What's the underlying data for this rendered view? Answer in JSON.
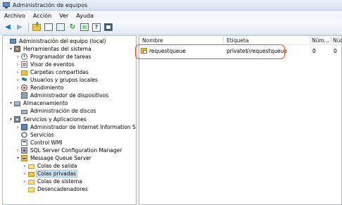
{
  "window": {
    "title": "Administración de equipos"
  },
  "menu": {
    "items": [
      "Archivo",
      "Acción",
      "Ver",
      "Ayuda"
    ]
  },
  "toolbar": {
    "icons": [
      "back-arrow-icon",
      "forward-arrow-icon",
      "up-folder-icon",
      "show-hide-console-tree-icon",
      "properties-icon",
      "refresh-icon",
      "export-list-icon",
      "help-icon",
      "action-pane-icon"
    ]
  },
  "tree": {
    "items": [
      {
        "label": "Administración del equipo (local)",
        "expander": "",
        "icon": "computer-icon"
      },
      {
        "label": "Herramientas del sistema",
        "expander": "▾",
        "icon": "tools-icon"
      },
      {
        "label": "Programador de tareas",
        "expander": "▹",
        "icon": "clock-icon"
      },
      {
        "label": "Visor de eventos",
        "expander": "▹",
        "icon": "event-viewer-icon"
      },
      {
        "label": "Carpetas compartidas",
        "expander": "▹",
        "icon": "shared-folder-icon"
      },
      {
        "label": "Usuarios y grupos locales",
        "expander": "▹",
        "icon": "users-icon"
      },
      {
        "label": "Rendimiento",
        "expander": "▹",
        "icon": "performance-icon"
      },
      {
        "label": "Administrador de dispositivos",
        "expander": "",
        "icon": "device-manager-icon"
      },
      {
        "label": "Almacenamiento",
        "expander": "▾",
        "icon": "storage-icon"
      },
      {
        "label": "Administración de discos",
        "expander": "",
        "icon": "disk-icon"
      },
      {
        "label": "Servicios y Aplicaciones",
        "expander": "▾",
        "icon": "services-apps-icon"
      },
      {
        "label": "Administrador de Internet Information Services",
        "expander": "▹",
        "icon": "iis-icon"
      },
      {
        "label": "Servicios",
        "expander": "",
        "icon": "gear-icon"
      },
      {
        "label": "Control WMI",
        "expander": "",
        "icon": "wmi-icon"
      },
      {
        "label": "SQL Server Configuration Manager",
        "expander": "▹",
        "icon": "sql-server-icon"
      },
      {
        "label": "Message Queue Server",
        "expander": "▾",
        "icon": "message-queue-icon"
      },
      {
        "label": "Colas de salida",
        "expander": "▹",
        "icon": "folder-icon"
      },
      {
        "label": "Colas privadas",
        "expander": "▹",
        "icon": "folder-icon"
      },
      {
        "label": "Colas de sistema",
        "expander": "▹",
        "icon": "folder-icon"
      },
      {
        "label": "Desencadenadores",
        "expander": "",
        "icon": "triggers-icon"
      }
    ],
    "selected": "Colas privadas"
  },
  "list": {
    "columns": [
      "Nombre",
      "Etiqueta",
      "Núm...",
      "Núm..."
    ],
    "rows": [
      {
        "name": "requestqueue",
        "label": "private$\\requestqueue",
        "count1": "0",
        "count2": "0"
      }
    ]
  },
  "colors": {
    "highlight_ring": "#e8542c",
    "selection": "#cce4f7"
  }
}
